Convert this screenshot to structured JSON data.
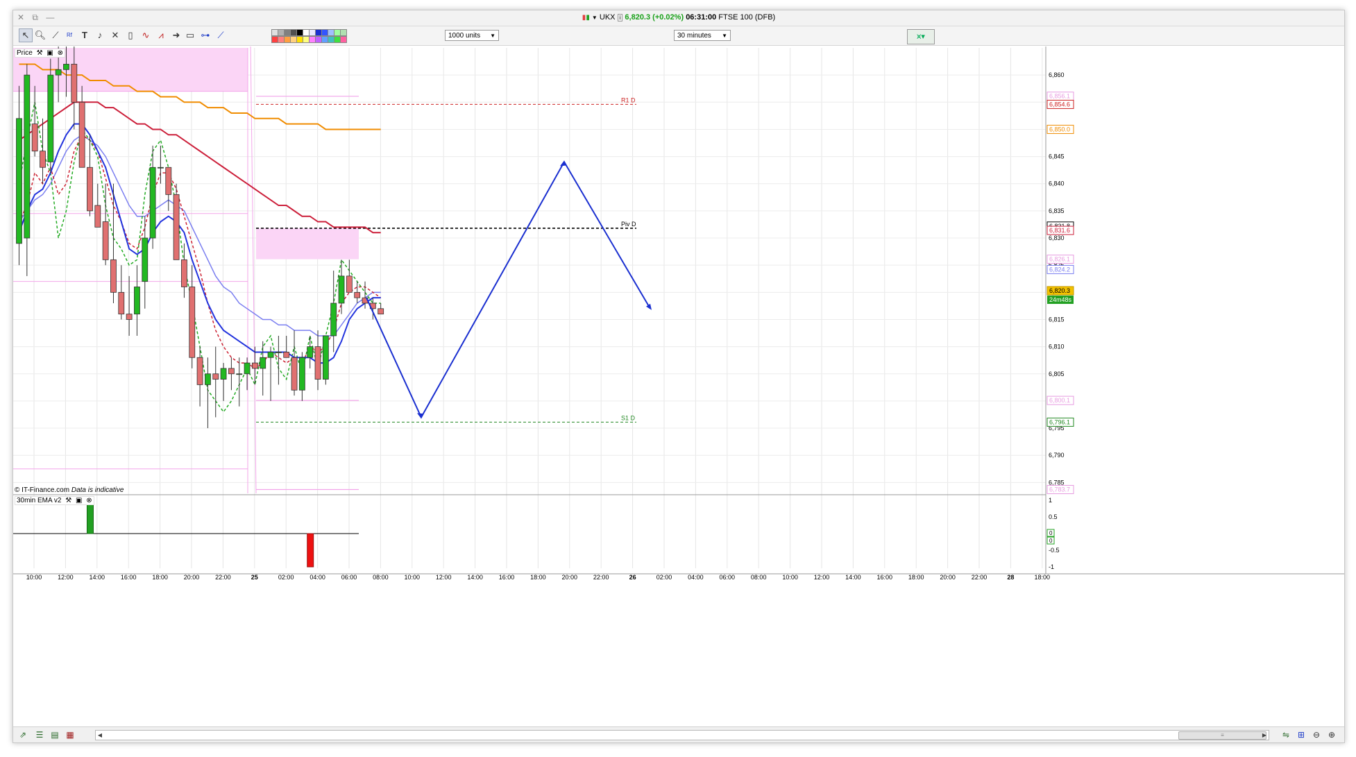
{
  "window": {
    "controls": [
      "✕",
      "⧉",
      "—"
    ],
    "symbol": "UKX",
    "price": "6,820.3",
    "change": "(+0.02%)",
    "time": "06:31:00",
    "instrument": "FTSE 100 (DFB)"
  },
  "toolbar": {
    "units_label": "1000 units",
    "interval_label": "30 minutes",
    "icons": [
      "cursor-icon",
      "zoom-icon",
      "draw-line-icon",
      "fibonacci-icon",
      "text-icon",
      "alert-bell-icon",
      "tools-icon",
      "trash-icon",
      "indicator-icon",
      "pattern-icon",
      "arrow-icon",
      "shape-icon",
      "crosshair-icon",
      "trendline-icon"
    ]
  },
  "colors": {
    "up_candle": "#22b822",
    "down_candle": "#e07070",
    "ema_fast": "#2233dd",
    "ema_mid": "#7a7ef0",
    "ema_slow": "#cc1f3a",
    "ema_long": "#f08c00",
    "pivot_band": "#f7b6f0",
    "drawing": "#1a2fd0"
  },
  "price_panel": {
    "label": "Price",
    "copyright": "© IT-Finance.com",
    "disclaimer": "Data is indicative",
    "price_ticks": [
      "6,860",
      "6,855",
      "6,850",
      "6,845",
      "6,840",
      "6,835",
      "6,830",
      "6,825",
      "6,820",
      "6,815",
      "6,810",
      "6,805",
      "6,800",
      "6,795",
      "6,790",
      "6,785"
    ],
    "level_labels": [
      {
        "text": "R1 D",
        "color": "#cc2222",
        "price": 6854.6
      },
      {
        "text": "Piv D",
        "color": "#000000",
        "price": 6831.8
      },
      {
        "text": "S1 D",
        "color": "#228822",
        "price": 6796.1
      }
    ],
    "price_tags": [
      {
        "text": "6,856.1",
        "color": "#e79be0",
        "price": 6856.1
      },
      {
        "text": "6,854.6",
        "color": "#cc2222",
        "price": 6854.6
      },
      {
        "text": "6,850.0",
        "color": "#f08c00",
        "price": 6850.0
      },
      {
        "text": "6,831.8",
        "color": "#000000",
        "price": 6832.2
      },
      {
        "text": "6,831.6",
        "color": "#cc1f3a",
        "price": 6831.4
      },
      {
        "text": "6,826.1",
        "color": "#e79be0",
        "price": 6826.1
      },
      {
        "text": "6,824.2",
        "color": "#7a7ef0",
        "price": 6824.2
      },
      {
        "text": "6,820.3",
        "color": "#e8a000",
        "price": 6820.3
      },
      {
        "text": "6,800.1",
        "color": "#e79be0",
        "price": 6800.1
      },
      {
        "text": "6,796.1",
        "color": "#228822",
        "price": 6796.1
      },
      {
        "text": "6,783.7",
        "color": "#e79be0",
        "price": 6783.7
      }
    ],
    "countdown": "24m48s"
  },
  "indicator_panel": {
    "label": "30min EMA v2",
    "ticks": [
      "1",
      "0.5",
      "0",
      "-0.5",
      "-1"
    ],
    "tags": [
      "0",
      "0"
    ]
  },
  "time_axis": [
    "10:00",
    "12:00",
    "14:00",
    "16:00",
    "18:00",
    "20:00",
    "22:00",
    "25",
    "02:00",
    "04:00",
    "06:00",
    "08:00",
    "10:00",
    "12:00",
    "14:00",
    "16:00",
    "18:00",
    "20:00",
    "22:00",
    "26",
    "02:00",
    "04:00",
    "06:00",
    "08:00",
    "10:00",
    "12:00",
    "14:00",
    "16:00",
    "18:00",
    "20:00",
    "22:00",
    "28",
    "18:00"
  ],
  "chart_data": {
    "type": "candlestick",
    "interval": "30 minutes",
    "ylim": [
      6782,
      6865
    ],
    "candles": [
      {
        "o": 6829,
        "h": 6858,
        "l": 6825,
        "c": 6852
      },
      {
        "o": 6830,
        "h": 6862,
        "l": 6823,
        "c": 6860
      },
      {
        "o": 6851,
        "h": 6858,
        "l": 6845,
        "c": 6846
      },
      {
        "o": 6846,
        "h": 6852,
        "l": 6840,
        "c": 6843
      },
      {
        "o": 6844,
        "h": 6863,
        "l": 6842,
        "c": 6860
      },
      {
        "o": 6860,
        "h": 6866,
        "l": 6855,
        "c": 6861
      },
      {
        "o": 6861,
        "h": 6866,
        "l": 6856,
        "c": 6862
      },
      {
        "o": 6862,
        "h": 6866,
        "l": 6850,
        "c": 6855
      },
      {
        "o": 6855,
        "h": 6858,
        "l": 6843,
        "c": 6843
      },
      {
        "o": 6843,
        "h": 6849,
        "l": 6834,
        "c": 6835
      },
      {
        "o": 6836,
        "h": 6840,
        "l": 6832,
        "c": 6832
      },
      {
        "o": 6833,
        "h": 6840,
        "l": 6825,
        "c": 6826
      },
      {
        "o": 6826,
        "h": 6840,
        "l": 6818,
        "c": 6820
      },
      {
        "o": 6820,
        "h": 6825,
        "l": 6815,
        "c": 6816
      },
      {
        "o": 6816,
        "h": 6823,
        "l": 6812,
        "c": 6815
      },
      {
        "o": 6816,
        "h": 6825,
        "l": 6812,
        "c": 6821
      },
      {
        "o": 6822,
        "h": 6834,
        "l": 6817,
        "c": 6830
      },
      {
        "o": 6830,
        "h": 6847,
        "l": 6828,
        "c": 6843
      },
      {
        "o": 6843,
        "h": 6847,
        "l": 6840,
        "c": 6843
      },
      {
        "o": 6843,
        "h": 6843,
        "l": 6835,
        "c": 6838
      },
      {
        "o": 6838,
        "h": 6840,
        "l": 6826,
        "c": 6826
      },
      {
        "o": 6826,
        "h": 6829,
        "l": 6819,
        "c": 6821
      },
      {
        "o": 6821,
        "h": 6825,
        "l": 6806,
        "c": 6808
      },
      {
        "o": 6808,
        "h": 6810,
        "l": 6799,
        "c": 6803
      },
      {
        "o": 6803,
        "h": 6808,
        "l": 6795,
        "c": 6805
      },
      {
        "o": 6805,
        "h": 6810,
        "l": 6797,
        "c": 6804
      },
      {
        "o": 6804,
        "h": 6807,
        "l": 6800,
        "c": 6806
      },
      {
        "o": 6806,
        "h": 6808,
        "l": 6802,
        "c": 6805
      },
      {
        "o": 6805,
        "h": 6808,
        "l": 6799,
        "c": 6805
      },
      {
        "o": 6805,
        "h": 6808,
        "l": 6802,
        "c": 6807
      },
      {
        "o": 6807,
        "h": 6810,
        "l": 6803,
        "c": 6806
      },
      {
        "o": 6806,
        "h": 6811,
        "l": 6801,
        "c": 6808
      },
      {
        "o": 6808,
        "h": 6810,
        "l": 6800,
        "c": 6809
      },
      {
        "o": 6809,
        "h": 6812,
        "l": 6803,
        "c": 6809
      },
      {
        "o": 6809,
        "h": 6812,
        "l": 6808,
        "c": 6808
      },
      {
        "o": 6808,
        "h": 6813,
        "l": 6801,
        "c": 6802
      },
      {
        "o": 6802,
        "h": 6809,
        "l": 6800,
        "c": 6808
      },
      {
        "o": 6808,
        "h": 6812,
        "l": 6806,
        "c": 6810
      },
      {
        "o": 6810,
        "h": 6813,
        "l": 6802,
        "c": 6804
      },
      {
        "o": 6804,
        "h": 6812,
        "l": 6803,
        "c": 6812
      },
      {
        "o": 6812,
        "h": 6824,
        "l": 6809,
        "c": 6818
      },
      {
        "o": 6818,
        "h": 6826,
        "l": 6816,
        "c": 6823
      },
      {
        "o": 6823,
        "h": 6826,
        "l": 6820,
        "c": 6820
      },
      {
        "o": 6820,
        "h": 6822,
        "l": 6818,
        "c": 6819
      },
      {
        "o": 6819,
        "h": 6822,
        "l": 6817,
        "c": 6818
      },
      {
        "o": 6818,
        "h": 6819,
        "l": 6815,
        "c": 6817
      },
      {
        "o": 6817,
        "h": 6818,
        "l": 6816,
        "c": 6816
      }
    ],
    "ema_fast": [
      6831,
      6835,
      6838,
      6839,
      6842,
      6846,
      6849,
      6851,
      6851,
      6849,
      6846,
      6843,
      6838,
      6833,
      6828,
      6827,
      6828,
      6831,
      6833,
      6834,
      6833,
      6831,
      6826,
      6822,
      6818,
      6815,
      6813,
      6812,
      6811,
      6810,
      6809,
      6809,
      6809,
      6809,
      6809,
      6808,
      6808,
      6808,
      6807,
      6807,
      6808,
      6811,
      6815,
      6817,
      6818,
      6819,
      6819
    ],
    "ema_mid": [
      6833,
      6835,
      6837,
      6838,
      6840,
      6843,
      6846,
      6848,
      6849,
      6848,
      6847,
      6845,
      6842,
      6839,
      6836,
      6834,
      6834,
      6835,
      6836,
      6837,
      6836,
      6835,
      6832,
      6829,
      6826,
      6823,
      6821,
      6820,
      6818,
      6817,
      6816,
      6815,
      6815,
      6814,
      6814,
      6813,
      6813,
      6813,
      6812,
      6812,
      6812,
      6814,
      6816,
      6818,
      6819,
      6820,
      6820
    ],
    "ema_slow": [
      6848,
      6849,
      6850,
      6851,
      6852,
      6853,
      6854,
      6855,
      6855,
      6855,
      6855,
      6854,
      6854,
      6853,
      6852,
      6851,
      6851,
      6850,
      6850,
      6849,
      6849,
      6848,
      6847,
      6846,
      6845,
      6844,
      6843,
      6842,
      6841,
      6840,
      6839,
      6838,
      6837,
      6836,
      6836,
      6835,
      6834,
      6834,
      6833,
      6833,
      6832,
      6832,
      6832,
      6832,
      6832,
      6831,
      6831
    ],
    "ema_long": [
      6862,
      6862,
      6862,
      6861,
      6861,
      6861,
      6860,
      6860,
      6860,
      6859,
      6859,
      6859,
      6858,
      6858,
      6858,
      6857,
      6857,
      6857,
      6856,
      6856,
      6856,
      6855,
      6855,
      6855,
      6854,
      6854,
      6854,
      6853,
      6853,
      6853,
      6852,
      6852,
      6852,
      6852,
      6851,
      6851,
      6851,
      6851,
      6851,
      6850,
      6850,
      6850,
      6850,
      6850,
      6850,
      6850,
      6850
    ],
    "dashed_fast": [
      6840,
      6848,
      6855,
      6846,
      6842,
      6830,
      6835,
      6844,
      6850,
      6848,
      6845,
      6836,
      6830,
      6828,
      6825,
      6826,
      6838,
      6846,
      6848,
      6843,
      6836,
      6825,
      6818,
      6810,
      6802,
      6800,
      6798,
      6800,
      6803,
      6806,
      6803,
      6810,
      6812,
      6806,
      6804,
      6810,
      6805,
      6812,
      6806,
      6812,
      6818,
      6826,
      6824,
      6822,
      6820,
      6818,
      6818
    ],
    "dashed_fast2": [
      6833,
      6836,
      6842,
      6840,
      6843,
      6838,
      6840,
      6846,
      6849,
      6848,
      6846,
      6841,
      6836,
      6833,
      6829,
      6828,
      6832,
      6838,
      6842,
      6842,
      6839,
      6834,
      6829,
      6824,
      6818,
      6813,
      6810,
      6808,
      6807,
      6807,
      6806,
      6807,
      6809,
      6808,
      6807,
      6808,
      6807,
      6810,
      6809,
      6810,
      6813,
      6818,
      6820,
      6821,
      6821,
      6820,
      6819
    ],
    "pivot_levels": {
      "R1": 6854.6,
      "Pivot": 6831.8,
      "S1": 6796.1
    },
    "drawn_path": [
      {
        "time": "06:30 25",
        "price": 6819
      },
      {
        "time": "10:30 25",
        "price": 6797
      },
      {
        "time": "19:30 25",
        "price": 6844
      },
      {
        "time": "02:30 26",
        "price": 6817
      }
    ],
    "indicator_bars": [
      {
        "time": "13:30 24",
        "value": 1
      },
      {
        "time": "03:30 25",
        "value": -1
      }
    ]
  }
}
